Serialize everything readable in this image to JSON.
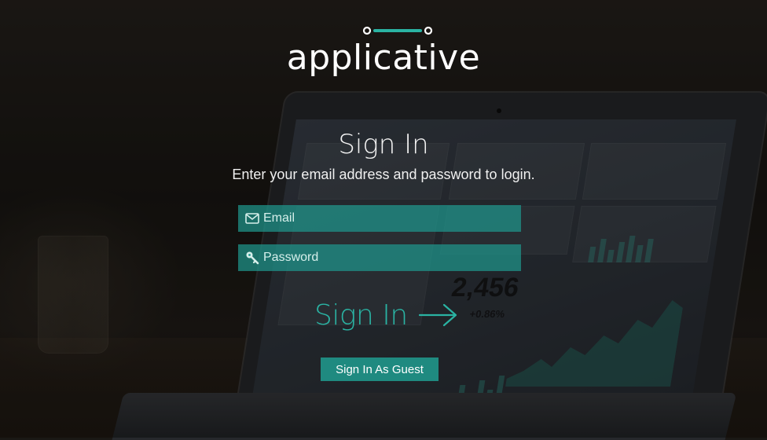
{
  "brand": {
    "name": "applicative",
    "accent_color": "#2ab3a3",
    "field_color": "#1f968c",
    "button_color": "#1f8a80"
  },
  "form": {
    "title": "Sign In",
    "subtitle": "Enter your email address and password to login.",
    "email": {
      "placeholder": "Email",
      "value": "",
      "icon": "envelope-icon"
    },
    "password": {
      "placeholder": "Password",
      "value": "",
      "icon": "key-icon"
    },
    "submit_label": "Sign In",
    "submit_icon": "arrow-right-icon",
    "guest_label": "Sign In As Guest"
  },
  "background": {
    "screen_number": "2,456",
    "screen_percent": "+0.86%"
  }
}
